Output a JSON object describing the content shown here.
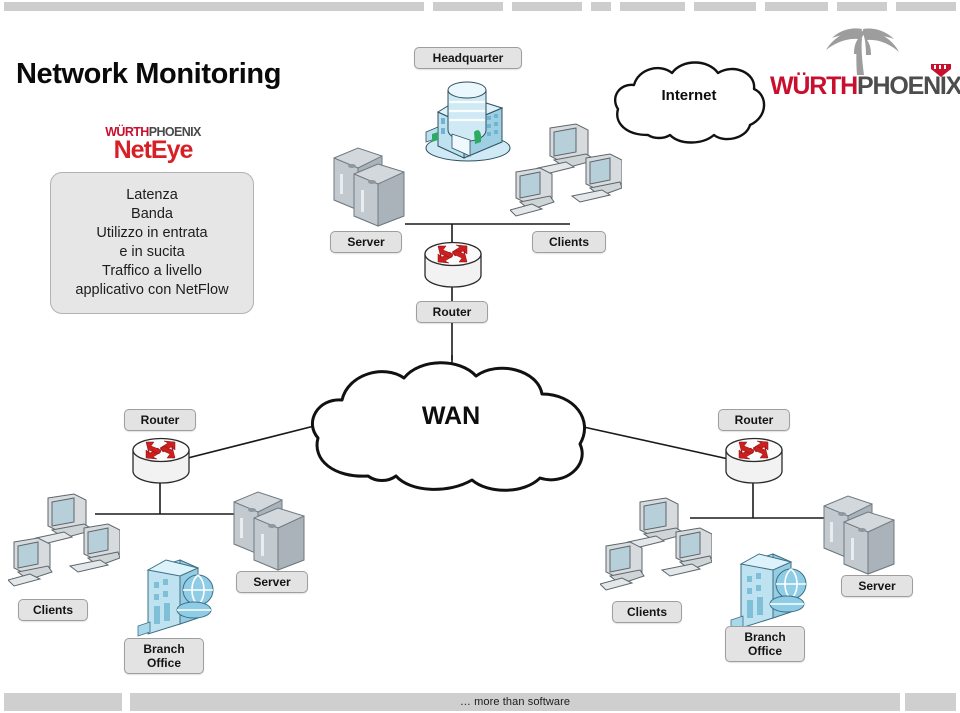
{
  "slide": {
    "title": "Network Monitoring",
    "footer_tagline": "… more than software"
  },
  "brand": {
    "neteye": {
      "wuerth": "WÜRTH",
      "phoenix": "PHOENIX",
      "product": "NetEye"
    },
    "corporate": {
      "wuerth": "WÜRTH",
      "phoenix": "PHOENIX",
      "palm_icon": "palm-tree-icon",
      "crest_icon": "wuerth-crest-icon"
    }
  },
  "callout": {
    "lines": [
      "Latenza",
      "Banda",
      "Utilizzo in entrata",
      "e in sucita",
      "Traffico a livello",
      "applicativo con NetFlow"
    ]
  },
  "diagram": {
    "headquarter": {
      "site_label": "Headquarter",
      "building_icon": "office-building-icon",
      "server_label": "Server",
      "server_icon": "server-tower-icon",
      "clients_label": "Clients",
      "clients_icon": "desktop-computer-icon",
      "router_label": "Router",
      "router_icon": "router-icon"
    },
    "internet": {
      "label": "Internet",
      "icon": "cloud-icon"
    },
    "wan": {
      "label": "WAN",
      "icon": "cloud-icon"
    },
    "branch_left": {
      "router_label": "Router",
      "router_icon": "router-icon",
      "clients_label": "Clients",
      "clients_icon": "desktop-computer-icon",
      "server_label": "Server",
      "server_icon": "server-tower-icon",
      "site_label": "Branch\nOffice",
      "site_icon": "branch-office-globe-icon"
    },
    "branch_right": {
      "router_label": "Router",
      "router_icon": "router-icon",
      "clients_label": "Clients",
      "clients_icon": "desktop-computer-icon",
      "server_label": "Server",
      "server_icon": "server-tower-icon",
      "site_label": "Branch\nOffice",
      "site_icon": "branch-office-globe-icon"
    }
  },
  "colors": {
    "brand_red": "#c8102e",
    "neteye_red": "#d61f26",
    "phoenix_gray": "#4d4d4d",
    "pill_fill": "#e3e3e3",
    "pill_border": "#9e9e9e",
    "rail_gray": "#cdcdcd",
    "router_arrow_red": "#cc1f1f",
    "building_blue": "#a9d9ea"
  }
}
